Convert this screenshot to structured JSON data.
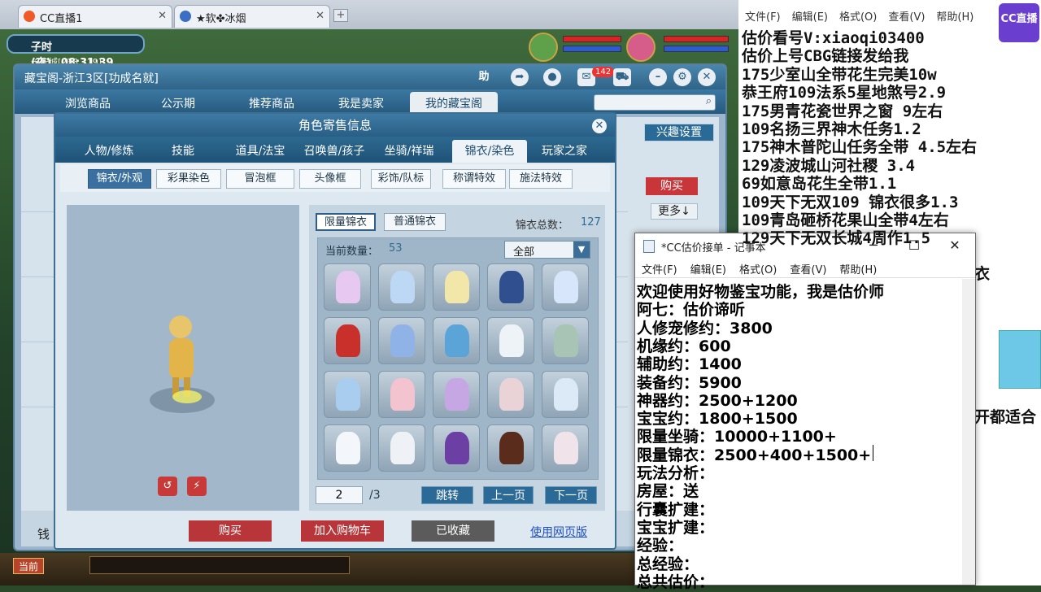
{
  "browser": {
    "tabs": [
      {
        "label": "CC直播1"
      },
      {
        "label": "★软✤冰烟"
      }
    ],
    "new_tab": "+"
  },
  "game": {
    "time_period": "子时(夜)",
    "clock": "08:31:39",
    "location": "长安城[233,119]",
    "toolbar_current": "当前",
    "money_label": "钱"
  },
  "cbg": {
    "title": "藏宝阁-浙江3区[功成名就]",
    "help": "助",
    "message_count": "142",
    "nav_tabs": [
      {
        "label": "浏览商品"
      },
      {
        "label": "公示期"
      },
      {
        "label": "推荐商品"
      },
      {
        "label": "我是卖家"
      },
      {
        "label": "我的藏宝阁"
      }
    ],
    "interest_settings": "兴趣设置",
    "buy_label": "购买",
    "more_label": "更多↓"
  },
  "dialog": {
    "title": "角色寄售信息",
    "tabs": [
      {
        "label": "人物/修炼"
      },
      {
        "label": "技能"
      },
      {
        "label": "道具/法宝"
      },
      {
        "label": "召唤兽/孩子"
      },
      {
        "label": "坐骑/祥瑞"
      },
      {
        "label": "锦衣/染色"
      },
      {
        "label": "玩家之家"
      }
    ],
    "sub_tabs": [
      {
        "label": "锦衣/外观"
      },
      {
        "label": "彩果染色"
      },
      {
        "label": "冒泡框"
      },
      {
        "label": "头像框"
      },
      {
        "label": "彩饰/队标"
      },
      {
        "label": "称谓特效"
      },
      {
        "label": "施法特效"
      }
    ],
    "panel_tabs": [
      {
        "label": "限量锦衣"
      },
      {
        "label": "普通锦衣"
      }
    ],
    "total_label": "锦衣总数：",
    "total_value": "127",
    "count_label": "当前数量：",
    "count_value": "53",
    "filter_value": "全部",
    "page_current": "2",
    "page_total": "/3",
    "jump": "跳转",
    "prev": "上一页",
    "next": "下一页",
    "actions": {
      "buy": "购买",
      "add_cart": "加入购物车",
      "favorited": "已收藏",
      "web_version": "使用网页版"
    },
    "items": [
      {
        "color": "#e6c8f0"
      },
      {
        "color": "#bcd8f5"
      },
      {
        "color": "#f2e7a8"
      },
      {
        "color": "#2f4f8f"
      },
      {
        "color": "#d7e6fa"
      },
      {
        "color": "#c9302c"
      },
      {
        "color": "#8fb3e6"
      },
      {
        "color": "#5aa4d8"
      },
      {
        "color": "#eef3f7"
      },
      {
        "color": "#a8c4b4"
      },
      {
        "color": "#a9cdef"
      },
      {
        "color": "#f4c3d0"
      },
      {
        "color": "#c7a7e3"
      },
      {
        "color": "#e9d3d6"
      },
      {
        "color": "#dce9f6"
      },
      {
        "color": "#f3f6fa"
      },
      {
        "color": "#eef2f6"
      },
      {
        "color": "#6b3fa4"
      },
      {
        "color": "#5a2c1c"
      },
      {
        "color": "#f1e3ea"
      }
    ]
  },
  "stream_notes": {
    "menu": [
      "文件(F)",
      "编辑(E)",
      "格式(O)",
      "查看(V)",
      "帮助(H)"
    ],
    "lines": [
      "估价看号V:xiaoqi03400",
      "估价上号CBG链接发给我",
      "175少室山全带花生完美10w",
      "恭王府109法系5星地煞号2.9",
      "175男青花瓷世界之窗  9左右",
      "109名扬三界神木任务1.2",
      "175神木普陀山任务全带 4.5左右",
      "129凌波城山河社稷  3.4",
      "69如意岛花生全带1.1",
      "109天下无双109  锦衣很多1.3",
      "109青岛砸桥花果山全带4左右",
      "129天下无双长城4周作1.5"
    ],
    "extra_right_1": "衣",
    "extra_right_2": "开都适合",
    "cc_logo": "CC直播"
  },
  "notepad": {
    "title": "*CC估价接单 - 记事本",
    "menu": [
      "文件(F)",
      "编辑(E)",
      "格式(O)",
      "查看(V)",
      "帮助(H)"
    ],
    "lines": [
      "欢迎使用好物鉴宝功能，我是估价师",
      "阿七：估价谛听",
      "人修宠修约：3800",
      "机缘约：600",
      "辅助约：1400",
      "装备约：5900",
      "神器约：2500+1200",
      "宝宝约：1800+1500",
      "限量坐骑：10000+1100+",
      "限量锦衣：2500+400+1500+",
      "玩法分析：",
      "房屋：送",
      "行囊扩建：",
      "宝宝扩建：",
      "经验：",
      "总经验：",
      "总共估价："
    ]
  }
}
